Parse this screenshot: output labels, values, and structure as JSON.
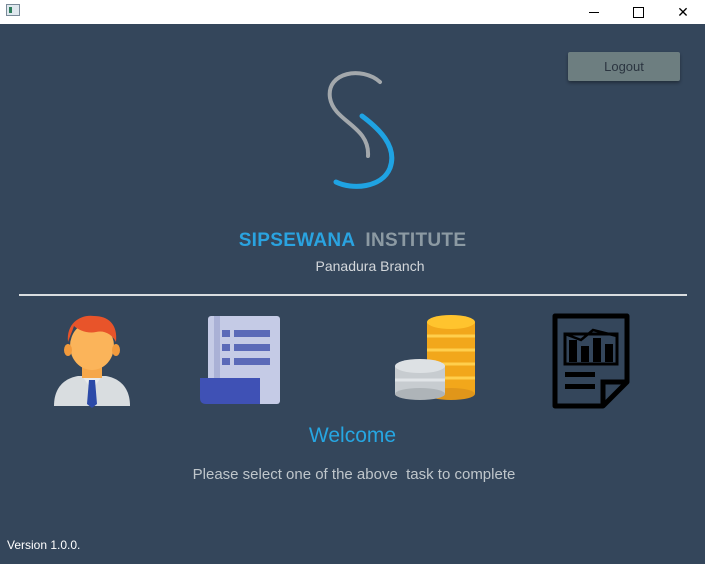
{
  "window": {
    "minimize_glyph": "—",
    "close_glyph": "✕"
  },
  "header": {
    "logout_label": "Logout",
    "brand_primary": "SIPSEWANA",
    "brand_secondary": "INSTITUTE",
    "branch": "Panadura Branch"
  },
  "tasks": [
    {
      "icon": "employee-icon"
    },
    {
      "icon": "document-list-icon"
    },
    {
      "icon": "coins-icon"
    },
    {
      "icon": "report-chart-icon"
    }
  ],
  "welcome": {
    "title": "Welcome",
    "instruction": "Please select one of the above  task to complete"
  },
  "footer": {
    "version": "Version 1.0.0."
  },
  "colors": {
    "background": "#34465b",
    "accent": "#26a6e2",
    "logout_button": "#6d7e80"
  }
}
